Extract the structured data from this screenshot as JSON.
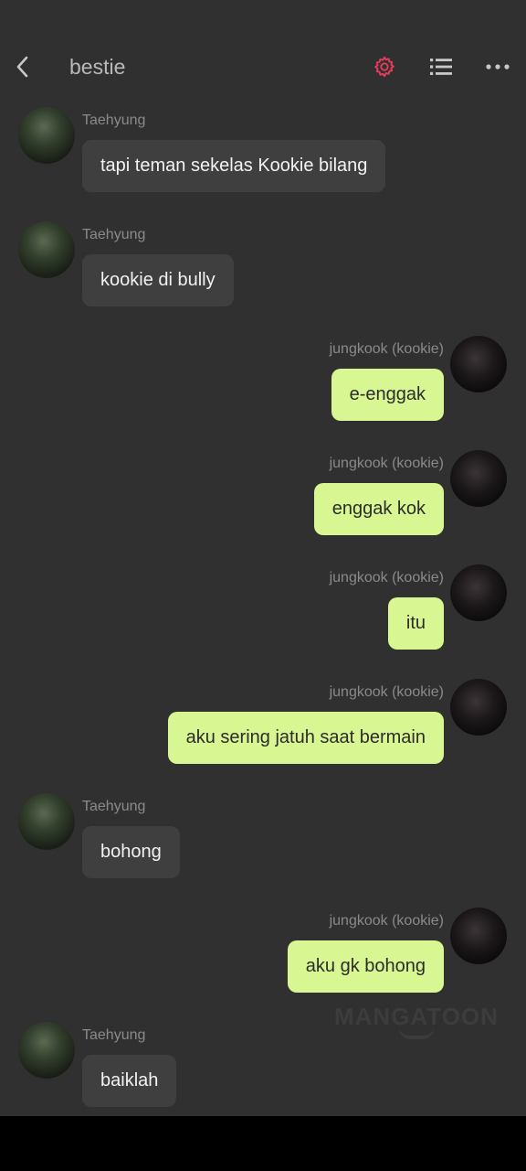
{
  "header": {
    "title": "bestie",
    "settings_icon": "gear-icon",
    "list_icon": "list-icon",
    "more_icon": "more-dots-icon",
    "accent_color": "#e33b5a"
  },
  "messages": [
    {
      "side": "left",
      "sender": "Taehyung",
      "text": "tapi teman sekelas Kookie bilang"
    },
    {
      "side": "left",
      "sender": "Taehyung",
      "text": "kookie di bully"
    },
    {
      "side": "right",
      "sender": "jungkook (kookie)",
      "text": "e-enggak"
    },
    {
      "side": "right",
      "sender": "jungkook (kookie)",
      "text": "enggak kok"
    },
    {
      "side": "right",
      "sender": "jungkook (kookie)",
      "text": "itu"
    },
    {
      "side": "right",
      "sender": "jungkook (kookie)",
      "text": "aku sering jatuh saat bermain"
    },
    {
      "side": "left",
      "sender": "Taehyung",
      "text": "bohong"
    },
    {
      "side": "right",
      "sender": "jungkook (kookie)",
      "text": "aku gk bohong"
    },
    {
      "side": "left",
      "sender": "Taehyung",
      "text": "baiklah"
    }
  ],
  "watermark": "MANGATOON",
  "colors": {
    "background": "#303030",
    "left_bubble": "#3f3f3f",
    "right_bubble": "#d8f692"
  }
}
